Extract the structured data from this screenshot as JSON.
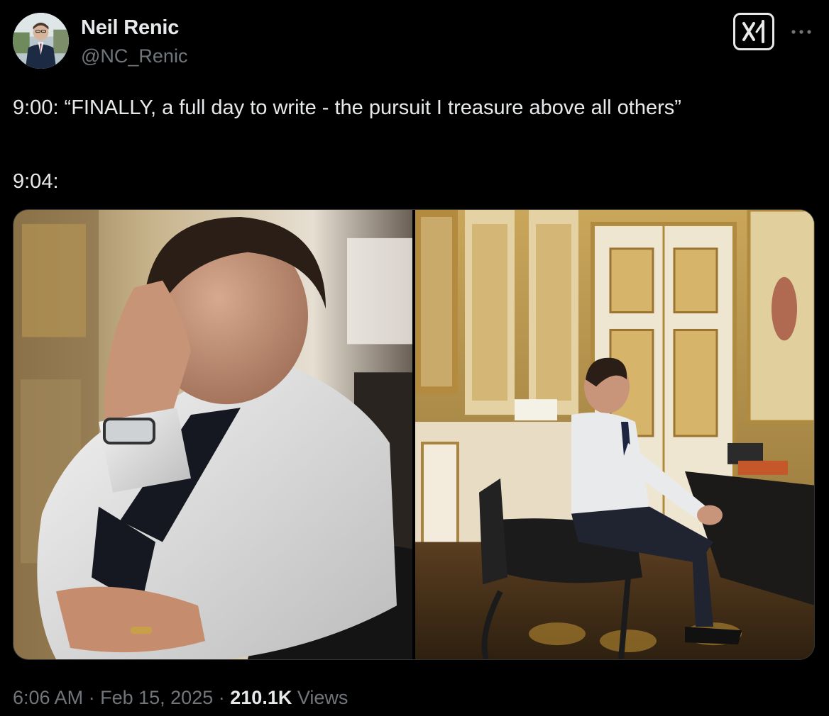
{
  "author": {
    "display_name": "Neil Renic",
    "handle": "@NC_Renic",
    "avatar_icon": "profile-photo"
  },
  "actions": {
    "grok_icon": "grok-icon",
    "more_icon": "more-icon"
  },
  "tweet": {
    "text": "9:00: “FINALLY, a full day to write - the pursuit I treasure above all others”\n\n9:04:"
  },
  "media": {
    "count": 2,
    "photos": [
      {
        "icon": "photo-man-hand-on-forehead"
      },
      {
        "icon": "photo-man-seated-ornate-office"
      }
    ]
  },
  "meta": {
    "time": "6:06 AM",
    "separator": "·",
    "date": "Feb 15, 2025",
    "views_count": "210.1K",
    "views_label": "Views"
  },
  "colors": {
    "background": "#000000",
    "text_primary": "#e7e9ea",
    "text_secondary": "#71767b",
    "border": "#2f3336"
  }
}
